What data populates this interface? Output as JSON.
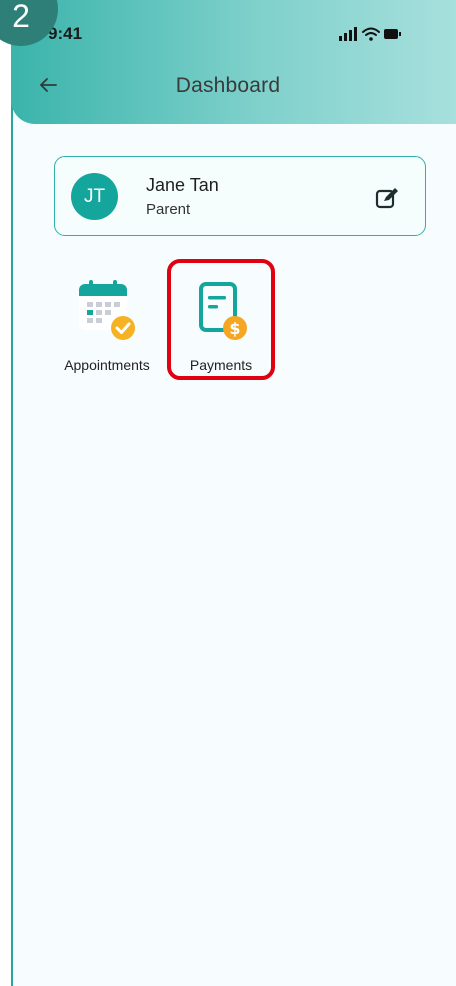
{
  "step": {
    "number": "2"
  },
  "status_bar": {
    "time": "9:41"
  },
  "header": {
    "title": "Dashboard",
    "back_icon": "arrow-left-icon"
  },
  "profile": {
    "initials": "JT",
    "name": "Jane Tan",
    "role": "Parent",
    "edit_icon": "edit-icon"
  },
  "tiles": [
    {
      "label": "Appointments",
      "icon": "calendar-check-icon"
    },
    {
      "label": "Payments",
      "icon": "invoice-dollar-icon"
    }
  ],
  "colors": {
    "teal": "#14a59c",
    "header_gradient_start": "#3ab4ab",
    "header_gradient_end": "#a7e0dd",
    "highlight": "#e00010",
    "coin": "#f5a623"
  }
}
